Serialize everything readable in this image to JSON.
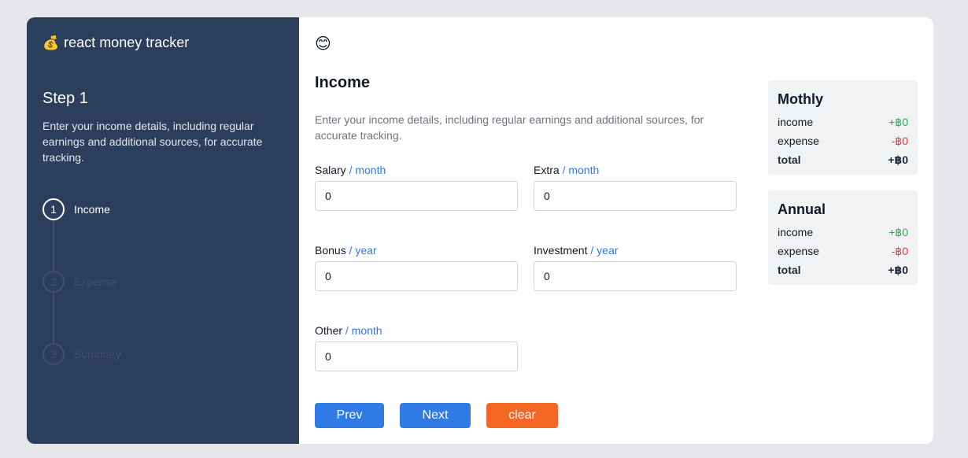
{
  "app": {
    "icon": "money-bag-icon",
    "icon_glyph": "💰",
    "title": "react money tracker"
  },
  "sidebar": {
    "step_title": "Step 1",
    "step_description": "Enter your income details, including regular earnings and additional sources, for accurate tracking.",
    "steps": [
      {
        "number": "1",
        "label": "Income",
        "state": "active"
      },
      {
        "number": "2",
        "label": "Expense",
        "state": "inactive"
      },
      {
        "number": "3",
        "label": "Summary",
        "state": "inactive"
      }
    ]
  },
  "main": {
    "emoji": "😊",
    "title": "Income",
    "description": "Enter your income details, including regular earnings and additional sources, for accurate tracking.",
    "fields": {
      "salary": {
        "label": "Salary",
        "unit": "/ month",
        "value": "0"
      },
      "extra": {
        "label": "Extra",
        "unit": "/ month",
        "value": "0"
      },
      "bonus": {
        "label": "Bonus",
        "unit": "/ year",
        "value": "0"
      },
      "investment": {
        "label": "Investment",
        "unit": "/ year",
        "value": "0"
      },
      "other": {
        "label": "Other",
        "unit": "/ month",
        "value": "0"
      }
    },
    "buttons": {
      "prev": "Prev",
      "next": "Next",
      "clear": "clear"
    }
  },
  "summary": {
    "monthly": {
      "title": "Mothly",
      "income_label": "income",
      "income_value": "+฿0",
      "expense_label": "expense",
      "expense_value": "-฿0",
      "total_label": "total",
      "total_value": "+฿0"
    },
    "annual": {
      "title": "Annual",
      "income_label": "income",
      "income_value": "+฿0",
      "expense_label": "expense",
      "expense_value": "-฿0",
      "total_label": "total",
      "total_value": "+฿0"
    }
  },
  "colors": {
    "sidebar_bg": "#2b3f5c",
    "accent_blue": "#2f7ae5",
    "clear_orange": "#f46623",
    "positive_green": "#22b14c",
    "negative_red": "#e03b3b"
  }
}
